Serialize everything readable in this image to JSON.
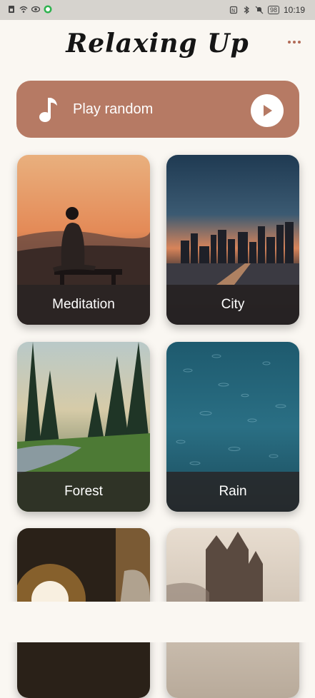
{
  "status_bar": {
    "time": "10:19",
    "battery": "98"
  },
  "header": {
    "title": "Relaxing Up"
  },
  "play_random": {
    "label": "Play random"
  },
  "categories": [
    {
      "label": "Meditation"
    },
    {
      "label": "City"
    },
    {
      "label": "Forest"
    },
    {
      "label": "Rain"
    },
    {
      "label": ""
    },
    {
      "label": ""
    }
  ],
  "colors": {
    "accent": "#b67a64",
    "background": "#faf7f2",
    "caption_overlay": "#282323"
  },
  "icons": [
    "more-icon",
    "music-note-icon",
    "play-icon"
  ]
}
